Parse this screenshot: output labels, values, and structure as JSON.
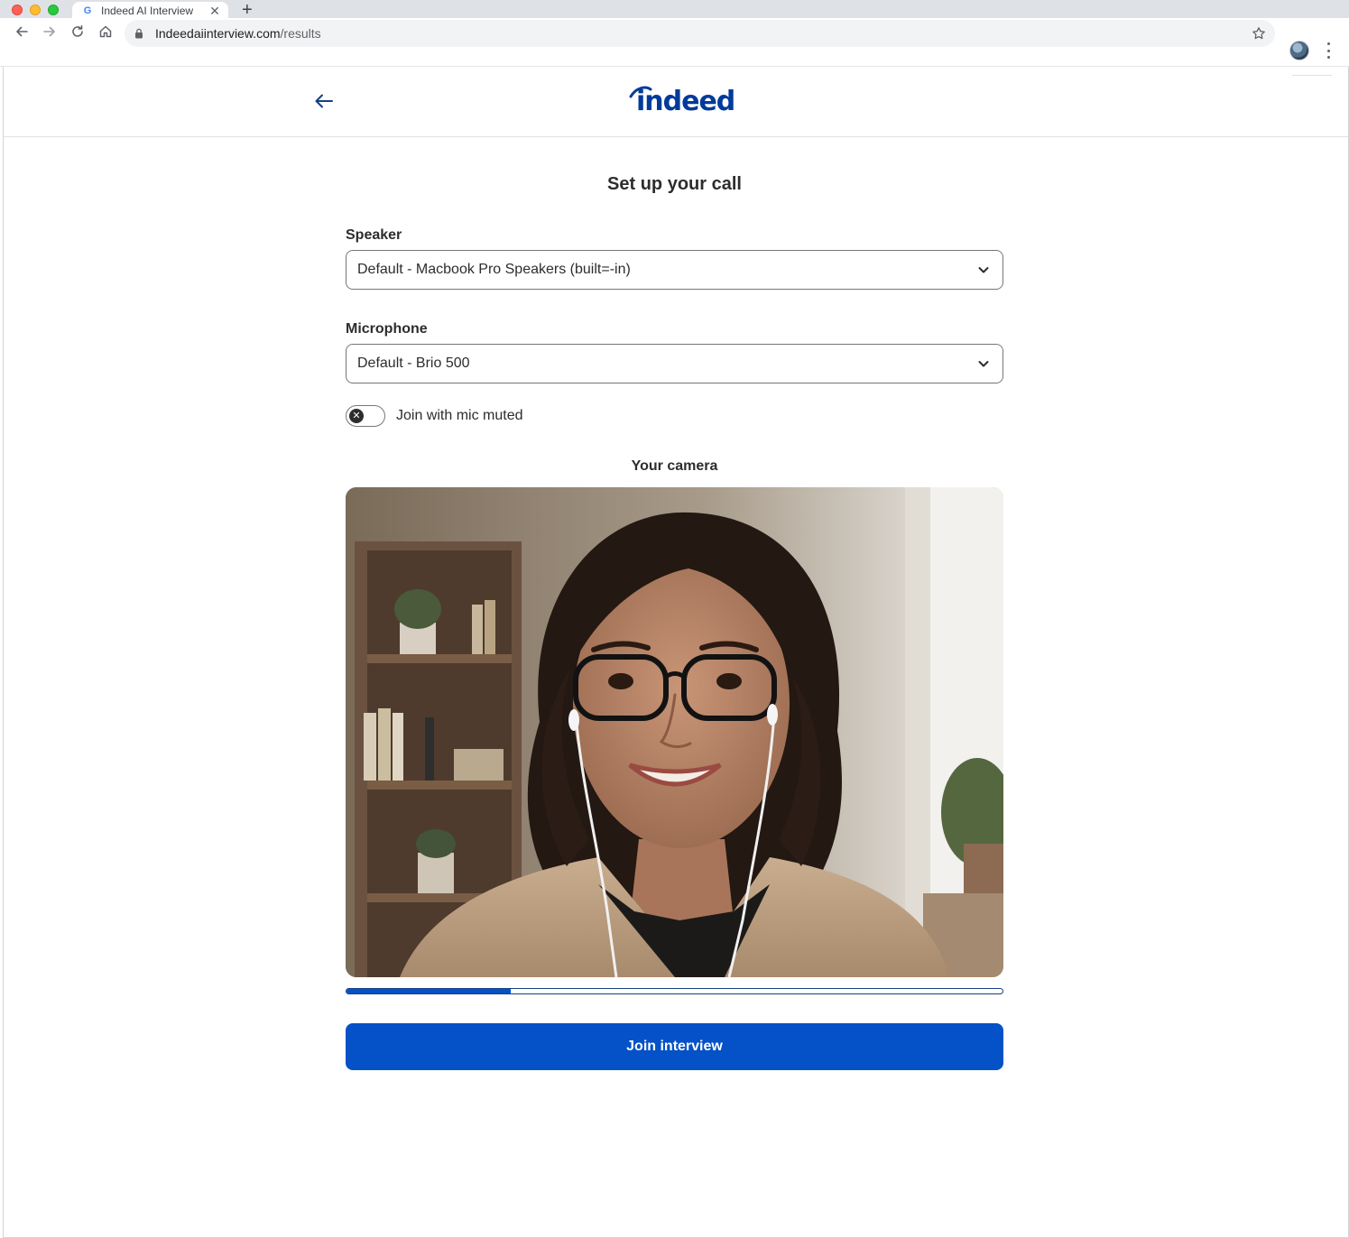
{
  "browser": {
    "tab_title": "Indeed AI Interview",
    "tab_favicon": "google-g-icon",
    "url_host": "Indeedaiinterview.com",
    "url_path": "/results"
  },
  "header": {
    "logo_text": "indeed",
    "back_icon": "arrow-left-icon"
  },
  "page": {
    "title": "Set up your call",
    "speaker_label": "Speaker",
    "speaker_value": "Default - Macbook Pro Speakers (built=-in)",
    "microphone_label": "Microphone",
    "microphone_value": "Default - Brio 500",
    "mute_toggle_label": "Join with mic muted",
    "mute_toggle_on": false,
    "camera_label": "Your camera",
    "audio_level": 0.25,
    "join_button": "Join interview"
  },
  "colors": {
    "brand_blue": "#0451c8",
    "logo_blue": "#003a9b",
    "progress_border": "#164081"
  }
}
